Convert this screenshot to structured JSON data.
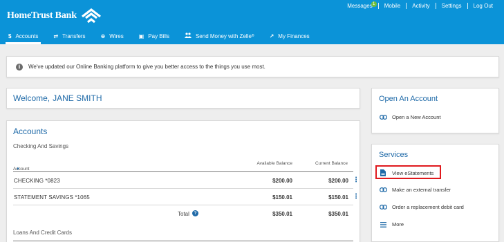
{
  "brand": {
    "name": "HomeTrust Bank",
    "primary_color": "#0b93d8",
    "accent_blue": "#1f6aa8"
  },
  "utility_nav": {
    "messages": "Messages",
    "messages_badge": "1",
    "mobile": "Mobile",
    "activity": "Activity",
    "settings": "Settings",
    "logout": "Log Out"
  },
  "main_nav": {
    "items": [
      {
        "label": "Accounts",
        "icon": "dollar-icon",
        "glyph": "$"
      },
      {
        "label": "Transfers",
        "icon": "transfer-arrows-icon",
        "glyph": "⇄"
      },
      {
        "label": "Wires",
        "icon": "globe-icon",
        "glyph": "⊕"
      },
      {
        "label": "Pay Bills",
        "icon": "bill-icon",
        "glyph": "▣"
      },
      {
        "label": "Send Money with Zelle",
        "icon": "people-icon",
        "glyph": "👥",
        "sup": "®"
      },
      {
        "label": "My Finances",
        "icon": "trend-icon",
        "glyph": "↗"
      }
    ],
    "active": "Accounts"
  },
  "notice": {
    "text": "We've updated our Online Banking platform to give you better access to the things you use most."
  },
  "welcome": {
    "label": "Welcome,",
    "name": "JANE SMITH"
  },
  "accounts": {
    "title": "Accounts",
    "checking_group": "Checking And Savings",
    "columns": {
      "account": "Account",
      "available": "Available Balance",
      "current": "Current Balance"
    },
    "sort_indicator": "▲",
    "rows": [
      {
        "name": "CHECKING  *0823",
        "available": "$200.00",
        "current": "$200.00"
      },
      {
        "name": "STATEMENT SAVINGS  *1065",
        "available": "$150.01",
        "current": "$150.01"
      }
    ],
    "total": {
      "label": "Total",
      "help": "?",
      "available": "$350.01",
      "current": "$350.01"
    },
    "loans_group": "Loans And Credit Cards"
  },
  "open_account": {
    "title": "Open An Account",
    "items": [
      {
        "label": "Open a New Account",
        "icon": "link-icon"
      }
    ]
  },
  "services": {
    "title": "Services",
    "items": [
      {
        "label": "View eStatements",
        "icon": "document-icon"
      },
      {
        "label": "Make an external transfer",
        "icon": "link-icon"
      },
      {
        "label": "Order a replacement debit card",
        "icon": "link-icon"
      },
      {
        "label": "More",
        "icon": "menu-icon"
      }
    ]
  }
}
